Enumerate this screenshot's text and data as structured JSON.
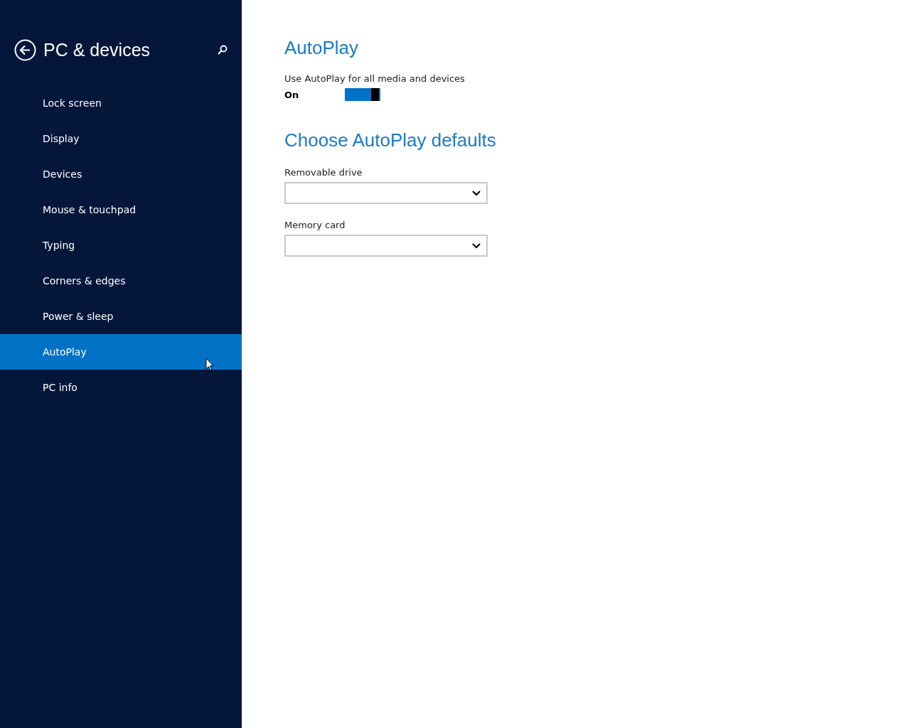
{
  "sidebar": {
    "title": "PC & devices",
    "items": [
      {
        "label": "Lock screen",
        "selected": false
      },
      {
        "label": "Display",
        "selected": false
      },
      {
        "label": "Devices",
        "selected": false
      },
      {
        "label": "Mouse & touchpad",
        "selected": false
      },
      {
        "label": "Typing",
        "selected": false
      },
      {
        "label": "Corners & edges",
        "selected": false
      },
      {
        "label": "Power & sleep",
        "selected": false
      },
      {
        "label": "AutoPlay",
        "selected": true
      },
      {
        "label": "PC info",
        "selected": false
      }
    ]
  },
  "main": {
    "title": "AutoPlay",
    "toggle": {
      "label": "Use AutoPlay for all media and devices",
      "state_text": "On",
      "on": true
    },
    "section_title": "Choose AutoPlay defaults",
    "dropdowns": [
      {
        "label": "Removable drive"
      },
      {
        "label": "Memory card"
      }
    ]
  }
}
